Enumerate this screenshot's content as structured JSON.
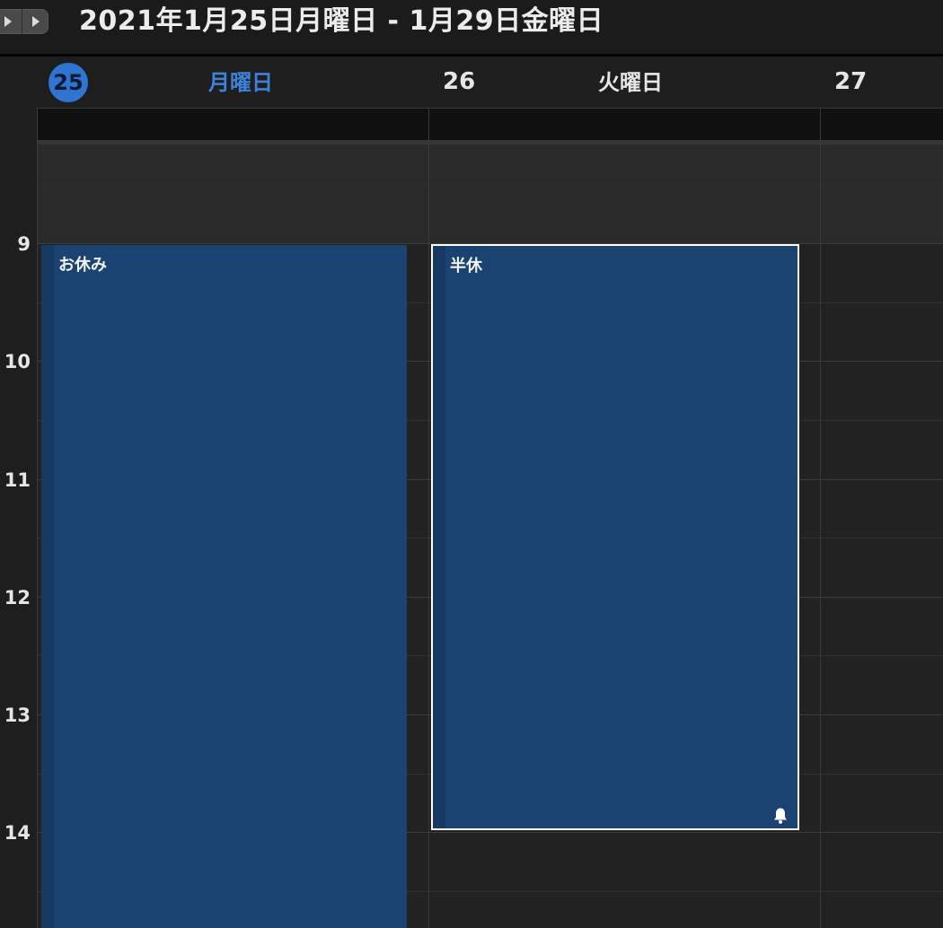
{
  "toolbar": {
    "date_range": "2021年1月25日月曜日 - 1月29日金曜日"
  },
  "days": [
    {
      "num": "25",
      "name": "月曜日",
      "is_today": true
    },
    {
      "num": "26",
      "name": "火曜日",
      "is_today": false
    },
    {
      "num": "27",
      "name": "",
      "is_today": false
    }
  ],
  "hours": [
    "9",
    "10",
    "11",
    "12",
    "13",
    "14"
  ],
  "events": [
    {
      "title": "お休み",
      "day": 0,
      "has_alert": false,
      "selected": false
    },
    {
      "title": "半休",
      "day": 1,
      "has_alert": true,
      "selected": true
    }
  ],
  "colors": {
    "accent": "#2f74d0",
    "event_fill": "#1a4372",
    "event_bar": "#163a63",
    "background": "#1e1e1e"
  },
  "icons": {
    "prev": "triangle-right-icon",
    "next": "triangle-right-icon",
    "alert": "bell-icon"
  }
}
